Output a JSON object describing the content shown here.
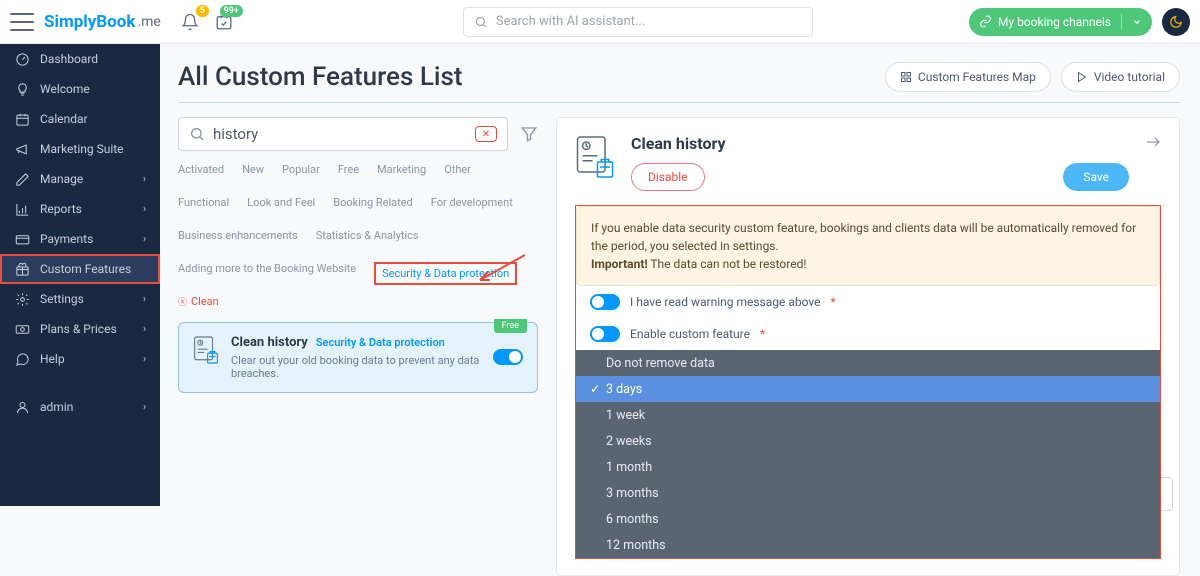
{
  "header": {
    "logo_main": "SimplyBook",
    "logo_suffix": ".me",
    "notif_badge": "5",
    "cal_badge": "99+",
    "search_placeholder": "Search with AI assistant...",
    "booking_channels": "My booking channels",
    "theme_icon": "moon"
  },
  "sidebar": {
    "items": [
      {
        "icon": "gauge",
        "label": "Dashboard"
      },
      {
        "icon": "bulb",
        "label": "Welcome"
      },
      {
        "icon": "calendar",
        "label": "Calendar"
      },
      {
        "icon": "megaphone",
        "label": "Marketing Suite"
      },
      {
        "icon": "pencil",
        "label": "Manage",
        "chev": true
      },
      {
        "icon": "chart",
        "label": "Reports",
        "chev": true
      },
      {
        "icon": "card",
        "label": "Payments",
        "chev": true
      },
      {
        "icon": "gift",
        "label": "Custom Features",
        "active": true,
        "highlighted": true
      },
      {
        "icon": "gear",
        "label": "Settings",
        "chev": true
      },
      {
        "icon": "money",
        "label": "Plans & Prices",
        "chev": true
      },
      {
        "icon": "chat",
        "label": "Help",
        "chev": true
      }
    ],
    "user": {
      "icon": "user",
      "label": "admin",
      "chev": true
    }
  },
  "page": {
    "title": "All Custom Features List",
    "map_btn": "Custom Features Map",
    "video_btn": "Video tutorial"
  },
  "search": {
    "value": "history"
  },
  "filters": {
    "row1": [
      "Activated",
      "New",
      "Popular",
      "Free",
      "Marketing",
      "Other"
    ],
    "row2": [
      "Functional",
      "Look and Feel",
      "Booking Related",
      "For development"
    ],
    "row3": [
      "Business enhancements",
      "Statistics & Analytics"
    ],
    "row4_a": "Adding more to the Booking Website",
    "row4_boxed": "Security & Data protection",
    "row4_clean": "Clean"
  },
  "feature_card": {
    "free": "Free",
    "title": "Clean history",
    "category": "Security & Data protection",
    "desc": "Clear out your old booking data to prevent any data breaches."
  },
  "panel": {
    "title": "Clean history",
    "disable": "Disable",
    "save": "Save",
    "warning_text": "If you enable data security custom feature, bookings and clients data will be automatically removed for the period, you selected in settings.",
    "warning_strong": "Important!",
    "warning_after": " The data can not be restored!",
    "toggle1": "I have read warning message above",
    "toggle2": "Enable custom feature",
    "dropdown": {
      "options": [
        "Do not remove data",
        "3 days",
        "1 week",
        "2 weeks",
        "1 month",
        "3 months",
        "6 months",
        "12 months"
      ],
      "selected_index": 1
    }
  }
}
